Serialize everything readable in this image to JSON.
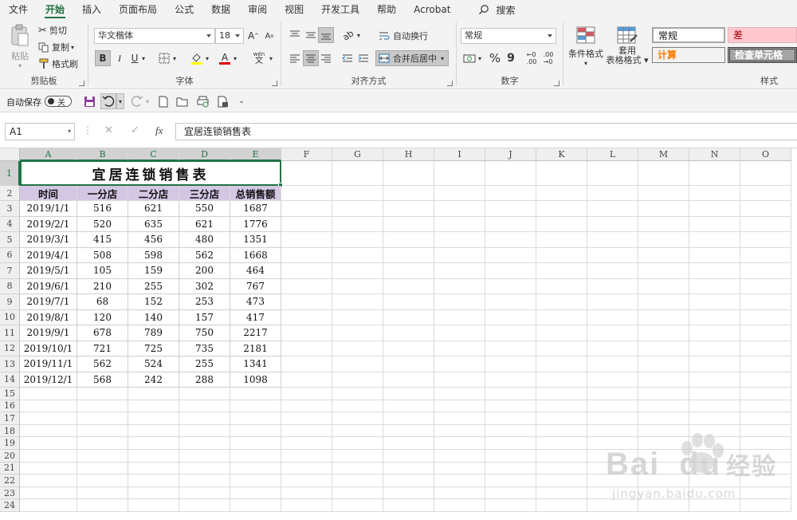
{
  "menu": {
    "tabs": [
      "文件",
      "开始",
      "插入",
      "页面布局",
      "公式",
      "数据",
      "审阅",
      "视图",
      "开发工具",
      "帮助",
      "Acrobat"
    ],
    "active": "开始",
    "search_label": "搜索"
  },
  "ribbon": {
    "clipboard": {
      "paste": "粘贴",
      "cut": "剪切",
      "copy": "复制",
      "format_painter": "格式刷",
      "label": "剪贴板"
    },
    "font": {
      "family": "华文楷体",
      "size": "18",
      "grow": "A",
      "shrink": "A",
      "bold": "B",
      "italic": "I",
      "underline": "U",
      "color_letter": "A",
      "phonetic": "wén",
      "label": "字体"
    },
    "alignment": {
      "wrap": "自动换行",
      "merge": "合并后居中",
      "label": "对齐方式"
    },
    "number": {
      "format": "常规",
      "percent": "%",
      "comma": "9",
      "label": "数字"
    },
    "styles": {
      "conditional": "条件格式",
      "table_format_1": "套用",
      "table_format_2": "表格格式",
      "normal": "常规",
      "bad": "差",
      "calculation": "计算",
      "check_cell": "检查单元格",
      "label": "样式"
    },
    "colors": {
      "accent": "#217346",
      "bad_bg": "#ffc7ce",
      "bad_fg": "#9c0006",
      "calc_bg": "#f2f2f2",
      "calc_fg": "#fa7d00",
      "check_bg": "#a5a5a5",
      "header_fill": "#d4c7e3"
    }
  },
  "qat": {
    "autosave": "自动保存",
    "autosave_state": "关"
  },
  "formula_bar": {
    "name_box": "A1",
    "cancel": "✕",
    "confirm": "✓",
    "fx": "fx",
    "content": "宜居连锁销售表"
  },
  "sheet": {
    "columns": [
      "A",
      "B",
      "C",
      "D",
      "E",
      "F",
      "G",
      "H",
      "I",
      "J",
      "K",
      "L",
      "M",
      "N",
      "O"
    ],
    "rows": [
      "1",
      "2",
      "3",
      "4",
      "5",
      "6",
      "7",
      "8",
      "9",
      "10",
      "11",
      "12",
      "13",
      "14",
      "15",
      "16",
      "17",
      "18",
      "19",
      "20",
      "21",
      "22",
      "23",
      "24"
    ],
    "title": "宜居连锁销售表",
    "headers": [
      "时间",
      "一分店",
      "二分店",
      "三分店",
      "总销售额"
    ],
    "data": [
      [
        "2019/1/1",
        "516",
        "621",
        "550",
        "1687"
      ],
      [
        "2019/2/1",
        "520",
        "635",
        "621",
        "1776"
      ],
      [
        "2019/3/1",
        "415",
        "456",
        "480",
        "1351"
      ],
      [
        "2019/4/1",
        "508",
        "598",
        "562",
        "1668"
      ],
      [
        "2019/5/1",
        "105",
        "159",
        "200",
        "464"
      ],
      [
        "2019/6/1",
        "210",
        "255",
        "302",
        "767"
      ],
      [
        "2019/7/1",
        "68",
        "152",
        "253",
        "473"
      ],
      [
        "2019/8/1",
        "120",
        "140",
        "157",
        "417"
      ],
      [
        "2019/9/1",
        "678",
        "789",
        "750",
        "2217"
      ],
      [
        "2019/10/1",
        "721",
        "725",
        "735",
        "2181"
      ],
      [
        "2019/11/1",
        "562",
        "524",
        "255",
        "1341"
      ],
      [
        "2019/12/1",
        "568",
        "242",
        "288",
        "1098"
      ]
    ]
  },
  "watermark": {
    "brand": "Bai",
    "brand2": "du",
    "cn": "经验",
    "url": "jingyan.baidu.com"
  }
}
